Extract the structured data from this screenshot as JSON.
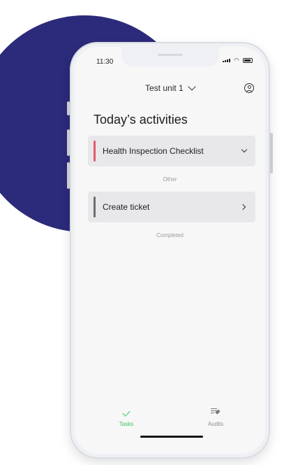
{
  "status_bar": {
    "time": "11:30",
    "icons": [
      "signal-icon",
      "wifi-icon",
      "battery-icon"
    ]
  },
  "header": {
    "unit_name": "Test unit 1",
    "unit_icon": "chevron-down-icon",
    "profile_icon": "user-circle-icon"
  },
  "main": {
    "title": "Today’s activities",
    "activities": [
      {
        "label": "Health Inspection Checklist",
        "accent_color": "#e55a6d",
        "icon": "chevron-down-icon"
      }
    ],
    "other_label": "Other",
    "other_items": [
      {
        "label": "Create ticket",
        "accent_color": "#6e6e72",
        "icon": "chevron-right-icon"
      }
    ],
    "completed_label": "Completed"
  },
  "tabbar": {
    "tabs": [
      {
        "label": "Tasks",
        "icon": "check-icon",
        "active": true
      },
      {
        "label": "Audits",
        "icon": "audits-list-icon",
        "active": false
      }
    ]
  },
  "colors": {
    "brand_circle": "#2c2a7a",
    "active_tab": "#3cc264"
  }
}
